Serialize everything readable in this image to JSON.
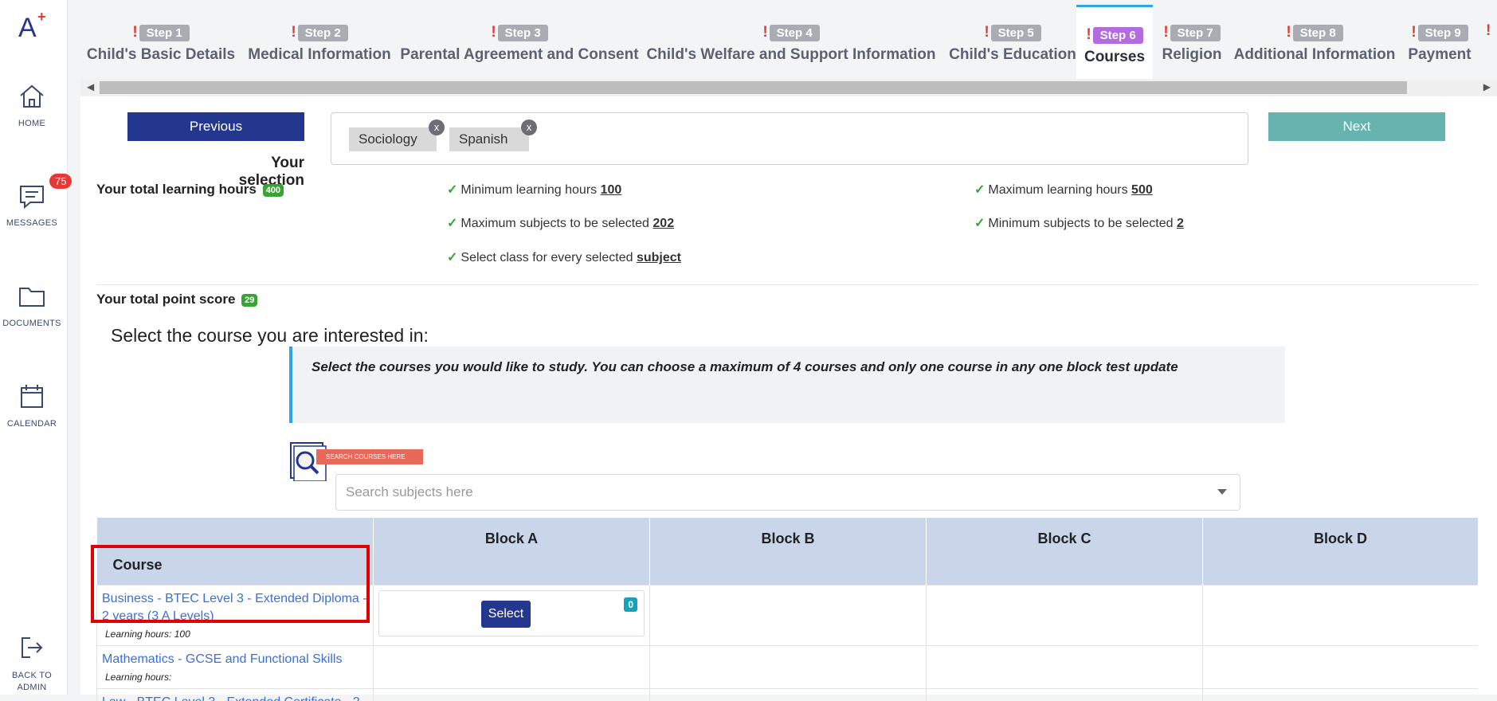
{
  "sidebar": {
    "logo_text": "A+",
    "items": [
      {
        "label": "HOME",
        "icon": "home-icon"
      },
      {
        "label": "MESSAGES",
        "icon": "message-icon",
        "badge": "75"
      },
      {
        "label": "DOCUMENTS",
        "icon": "folder-icon"
      },
      {
        "label": "CALENDAR",
        "icon": "calendar-icon"
      }
    ],
    "back_label_line1": "BACK TO",
    "back_label_line2": "ADMIN"
  },
  "tabs": [
    {
      "step": "Step 1",
      "title": "Child's Basic Details"
    },
    {
      "step": "Step 2",
      "title": "Medical Information"
    },
    {
      "step": "Step 3",
      "title": "Parental Agreement and Consent"
    },
    {
      "step": "Step 4",
      "title": "Child's Welfare and Support Information"
    },
    {
      "step": "Step 5",
      "title": "Child's Education"
    },
    {
      "step": "Step 6",
      "title": "Courses"
    },
    {
      "step": "Step 7",
      "title": "Religion"
    },
    {
      "step": "Step 8",
      "title": "Additional Information"
    },
    {
      "step": "Step 9",
      "title": "Payment"
    }
  ],
  "tab_warn": "!",
  "nav": {
    "previous": "Previous",
    "next": "Next"
  },
  "selection": {
    "label": "Your selection",
    "chips": [
      {
        "label": "Sociology"
      },
      {
        "label": "Spanish"
      }
    ],
    "chip_remove": "x"
  },
  "summary": {
    "learning_hours_label": "Your total learning hours",
    "learning_hours_value": "400",
    "point_score_label": "Your total point score",
    "point_score_value": "29"
  },
  "rules": [
    {
      "text": "Minimum learning hours",
      "value": "100"
    },
    {
      "text": "Maximum learning hours",
      "value": "500"
    },
    {
      "text": "Maximum subjects to be selected",
      "value": "202"
    },
    {
      "text": "Minimum subjects to be selected",
      "value": "2"
    },
    {
      "text": "Select class for every selected",
      "value": "subject"
    }
  ],
  "rule_check": "✓",
  "heading": "Select the course you are interested in:",
  "note": "Select the courses you would like to study. You can choose a maximum of 4 courses and only one course in any one block test update",
  "search": {
    "banner": "SEARCH COURSES HERE",
    "placeholder": "Search subjects here"
  },
  "table": {
    "headers": [
      "Course",
      "Block A",
      "Block B",
      "Block C",
      "Block D"
    ],
    "rows": [
      {
        "course": "Business - BTEC Level 3 - Extended Diploma - 2 years (3 A Levels)",
        "hours": "Learning hours: 100",
        "select": "Select",
        "count": "0"
      },
      {
        "course": "Mathematics - GCSE and Functional Skills",
        "hours": "Learning hours:"
      },
      {
        "course": "Law - BTEC Level 3 - Extended Certificate - 2"
      }
    ]
  },
  "colors": {
    "primary": "#24378e",
    "next": "#66b3b0",
    "active_step": "#b26be0",
    "warn": "#e53935",
    "highlight": "#e00000"
  }
}
